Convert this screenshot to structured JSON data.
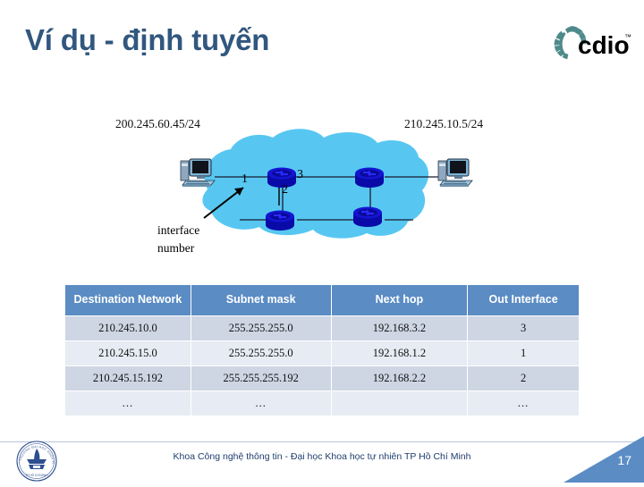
{
  "slide": {
    "title": "Ví dụ - định tuyến",
    "title_color": "#31577E"
  },
  "brand": {
    "logo_name": "cdio-logo",
    "logo_text": "cdio",
    "logo_tm": "™",
    "logo_arc_color": "#4E8A8A"
  },
  "diagram": {
    "left_ip_label": "200.245.60.45/24",
    "right_ip_label": "210.245.10.5/24",
    "cloud_color": "#57C7F2",
    "router_color": "#1414D2",
    "interface_numbers": {
      "one": "1",
      "two": "2",
      "three": "3"
    },
    "annotation_line1": "interface",
    "annotation_line2": "number"
  },
  "routing_table": {
    "headers": [
      "Destination Network",
      "Subnet mask",
      "Next hop",
      "Out Interface"
    ],
    "header_bg": "#5B8CC4",
    "row_bg_odd": "#CED6E4",
    "row_bg_even": "#E7EBF3",
    "rows": [
      {
        "destination": "210.245.10.0",
        "mask": "255.255.255.0",
        "next_hop": "192.168.3.2",
        "out_interface": "3"
      },
      {
        "destination": "210.245.15.0",
        "mask": "255.255.255.0",
        "next_hop": "192.168.1.2",
        "out_interface": "1"
      },
      {
        "destination": "210.245.15.192",
        "mask": "255.255.255.192",
        "next_hop": "192.168.2.2",
        "out_interface": "2"
      },
      {
        "destination": "...",
        "mask": "...",
        "next_hop": "",
        "out_interface": "..."
      }
    ]
  },
  "footer": {
    "text": "Khoa Công nghệ thông tin - Đại học Khoa học tự nhiên TP Hồ Chí Minh",
    "page_number": "17",
    "seal_name": "university-seal",
    "corner_color": "#5B8CC4"
  }
}
